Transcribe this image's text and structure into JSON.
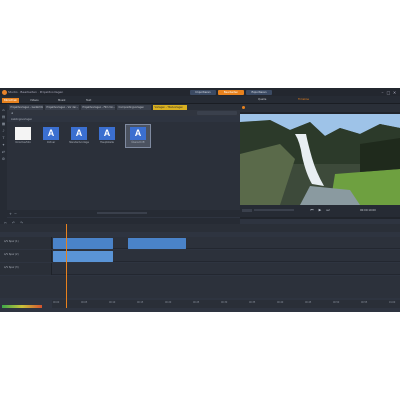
{
  "title_bar": {
    "title": "Studio · Bearbeiten · Projektvorlagen",
    "modes": [
      "Importieren",
      "Bearbeiten",
      "Exportieren"
    ],
    "active_mode": 1
  },
  "menu": {
    "items": [
      "Bibliothek",
      "Videos",
      "Musik",
      "Text"
    ],
    "active_index": 0,
    "right_tabs": [
      "Quelle",
      "Timeline"
    ]
  },
  "doc_tabs": [
    "Projektvorlagen - Gedächtni...",
    "Projektvorlagen - Vor der...",
    "Projektvorlagen - Film Vor...",
    "Compositingvorlagen",
    "Vorlagen - Titelvorlagen"
  ],
  "active_doc_tab": 4,
  "library": {
    "folder": "Lieblingsvorlagen",
    "items": [
      {
        "label": "Vorschaufoto",
        "glyph": "",
        "style": "white"
      },
      {
        "label": "Ordner",
        "glyph": "A",
        "style": "blue"
      },
      {
        "label": "Standardvorlage",
        "glyph": "A",
        "style": "blue"
      },
      {
        "label": "Hauptstelle",
        "glyph": "A",
        "style": "blue"
      },
      {
        "label": "Überschrift",
        "glyph": "A",
        "style": "blue"
      }
    ],
    "selected_index": 4
  },
  "preview": {
    "timecode": "00:00:10:00"
  },
  "timeline": {
    "tracks": [
      {
        "name": "A/V Spur (1)"
      },
      {
        "name": "A/V Spur (2)"
      },
      {
        "name": "A/V Spur (3)"
      }
    ],
    "ruler_labels": [
      "00:00",
      "00:05",
      "00:10",
      "00:15",
      "00:20",
      "00:25",
      "00:30",
      "00:35",
      "00:40",
      "00:45",
      "00:50",
      "00:55",
      "01:00"
    ]
  },
  "colors": {
    "accent": "#e8821e",
    "panel": "#2e3440",
    "clip_blue": "#4a83c9",
    "tab_yellow": "#d9b020"
  },
  "icons": {
    "minimize": "–",
    "maximize": "□",
    "close": "✕",
    "play": "▶",
    "prev": "⏮",
    "next": "⏭"
  }
}
